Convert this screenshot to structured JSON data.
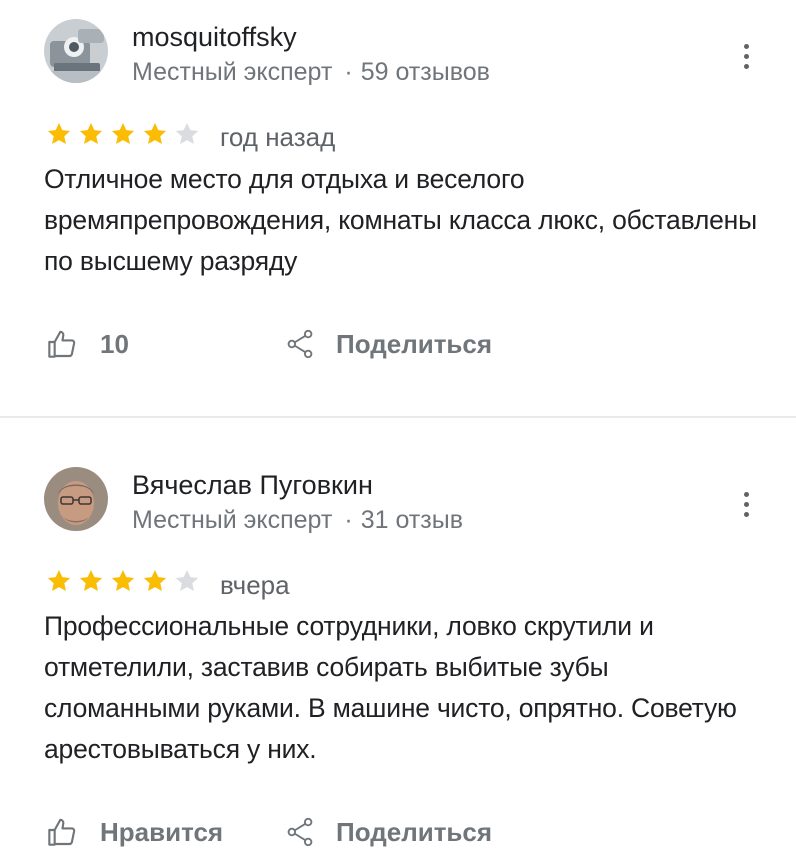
{
  "reviews": [
    {
      "author": "mosquitoffsky",
      "badge": "Местный эксперт",
      "separator": "·",
      "count": "59 отзывов",
      "rating": 4,
      "max_rating": 5,
      "date": "год назад",
      "text": "Отличное место для отдыха и веселого времяпрепровождения, комнаты класса люкс, обставлены по высшему разряду",
      "like_label": "10",
      "share_label": "Поделиться"
    },
    {
      "author": "Вячеслав Пуговкин",
      "badge": "Местный эксперт",
      "separator": "·",
      "count": "31 отзыв",
      "rating": 4,
      "max_rating": 5,
      "date": "вчера",
      "text": "Профессиональные сотрудники, ловко скрутили и отметелили, заставив собирать выбитые зубы сломанными руками. В машине чисто, опрятно. Советую арестовываться у них.",
      "like_label": "Нравится",
      "share_label": "Поделиться"
    }
  ],
  "colors": {
    "star_filled": "#fbbc04",
    "star_empty": "#dadce0",
    "secondary_text": "#70757a",
    "divider": "#e8eaed"
  }
}
